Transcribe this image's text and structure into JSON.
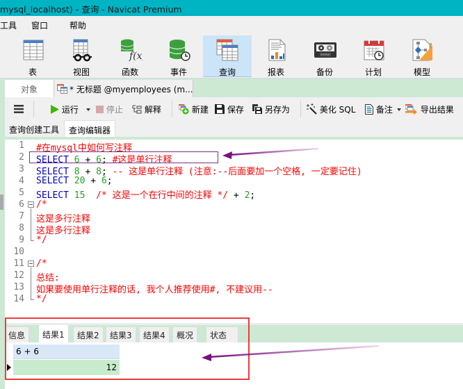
{
  "window": {
    "title": "mysql_localhost) - 查询 - Navicat Premium"
  },
  "menu": [
    {
      "label": "工具"
    },
    {
      "label": "窗口"
    },
    {
      "label": "帮助"
    }
  ],
  "ribbon": [
    {
      "label": "表",
      "icon": "table-icon"
    },
    {
      "label": "视图",
      "icon": "view-icon"
    },
    {
      "label": "函数",
      "icon": "function-icon"
    },
    {
      "label": "事件",
      "icon": "event-icon"
    },
    {
      "label": "查询",
      "icon": "query-icon",
      "active": true
    },
    {
      "label": "报表",
      "icon": "report-icon"
    },
    {
      "label": "备份",
      "icon": "backup-icon"
    },
    {
      "label": "计划",
      "icon": "schedule-icon"
    },
    {
      "label": "模型",
      "icon": "model-icon"
    }
  ],
  "tabs": {
    "objects": "对象",
    "document": "* 无标题 @myemployees (m..."
  },
  "toolbar": {
    "run": "运行",
    "stop": "停止",
    "explain": "解释",
    "new": "新建",
    "save": "保存",
    "save_as": "另存为",
    "beautify": "美化 SQL",
    "comment": "备注",
    "export": "导出结果"
  },
  "subtabs": [
    {
      "label": "查询创建工具"
    },
    {
      "label": "查询编辑器",
      "active": true
    }
  ],
  "editor": {
    "lines": [
      {
        "n": "1",
        "tokens": [
          {
            "t": "#在mysql中如何写注释",
            "c": "cm"
          }
        ]
      },
      {
        "n": "2",
        "tokens": [
          {
            "t": "SELECT ",
            "c": "kw"
          },
          {
            "t": "6",
            "c": "num"
          },
          {
            "t": " + ",
            "c": "op"
          },
          {
            "t": "6",
            "c": "num"
          },
          {
            "t": "; ",
            "c": "op"
          },
          {
            "t": "#这是单行注释",
            "c": "cm"
          }
        ]
      },
      {
        "n": "3",
        "tokens": [
          {
            "t": "SELECT ",
            "c": "kw"
          },
          {
            "t": "8",
            "c": "num"
          },
          {
            "t": " + ",
            "c": "op"
          },
          {
            "t": "8",
            "c": "num"
          },
          {
            "t": "; ",
            "c": "op"
          },
          {
            "t": "-- 这是单行注释 (注意:--后面要加一个空格, 一定要记住)",
            "c": "cm"
          }
        ]
      },
      {
        "n": "4",
        "tokens": [
          {
            "t": "SELECT ",
            "c": "kw"
          },
          {
            "t": "20",
            "c": "num"
          },
          {
            "t": " + ",
            "c": "op"
          },
          {
            "t": "6",
            "c": "num"
          },
          {
            "t": ";",
            "c": "op"
          }
        ]
      },
      {
        "n": "5",
        "tokens": [
          {
            "t": "SELECT ",
            "c": "kw"
          },
          {
            "t": "15",
            "c": "num"
          },
          {
            "t": "  ",
            "c": "op"
          },
          {
            "t": "/* 这是一个在行中间的注释 */",
            "c": "cm"
          },
          {
            "t": " + ",
            "c": "op"
          },
          {
            "t": "2",
            "c": "num"
          },
          {
            "t": ";",
            "c": "op"
          }
        ]
      },
      {
        "n": "6",
        "tokens": [
          {
            "t": "/*",
            "c": "cm"
          }
        ],
        "fold": "start"
      },
      {
        "n": "7",
        "tokens": [
          {
            "t": "这是多行注释",
            "c": "cm"
          }
        ]
      },
      {
        "n": "8",
        "tokens": [
          {
            "t": "这是多行注释",
            "c": "cm"
          }
        ]
      },
      {
        "n": "9",
        "tokens": [
          {
            "t": "*/",
            "c": "cm"
          }
        ],
        "fold": "end"
      },
      {
        "n": "10",
        "tokens": []
      },
      {
        "n": "11",
        "tokens": [
          {
            "t": "/*",
            "c": "cm"
          }
        ],
        "fold": "start"
      },
      {
        "n": "12",
        "tokens": [
          {
            "t": "总结:",
            "c": "cm"
          }
        ]
      },
      {
        "n": "13",
        "tokens": [
          {
            "t": "如果要使用单行注释的话, 我个人推荐使用#, 不建议用--",
            "c": "cm"
          }
        ]
      },
      {
        "n": "14",
        "tokens": [
          {
            "t": "*/",
            "c": "cm"
          }
        ],
        "fold": "end"
      }
    ]
  },
  "results": {
    "tabs": [
      {
        "label": "信息"
      },
      {
        "label": "结果1",
        "active": true
      },
      {
        "label": "结果2"
      },
      {
        "label": "结果3"
      },
      {
        "label": "结果4"
      },
      {
        "label": "概况"
      },
      {
        "label": "状态"
      }
    ],
    "columns": [
      "6 + 6"
    ],
    "rows": [
      [
        "12"
      ]
    ]
  },
  "annotations": {
    "highlight_color": "#7b2d8e",
    "result_box_color": "#ef3b3b"
  }
}
